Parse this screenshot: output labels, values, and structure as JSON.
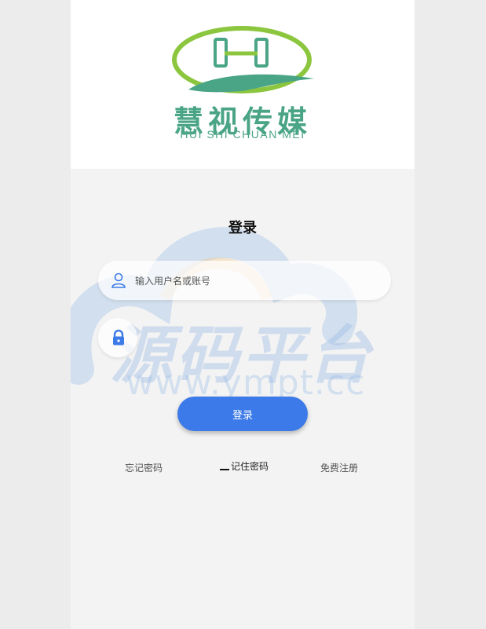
{
  "brand": {
    "name_cn": "慧视传媒",
    "name_en": "HUI SHI CHUAN MEI",
    "colors": {
      "green": "#4aa486",
      "lime": "#8cc63f",
      "accent": "#3b7ae8"
    }
  },
  "watermark": {
    "text_cn": "源码平台",
    "url": "www.ympt.cc"
  },
  "login": {
    "title": "登录",
    "username": {
      "placeholder": "输入用户名或账号",
      "value": "",
      "icon": "user-icon"
    },
    "password": {
      "placeholder": "",
      "value": "",
      "icon": "lock-icon"
    },
    "submit_label": "登录"
  },
  "links": {
    "forgot": "忘记密码",
    "remember": "记住密码",
    "register": "免费注册"
  }
}
